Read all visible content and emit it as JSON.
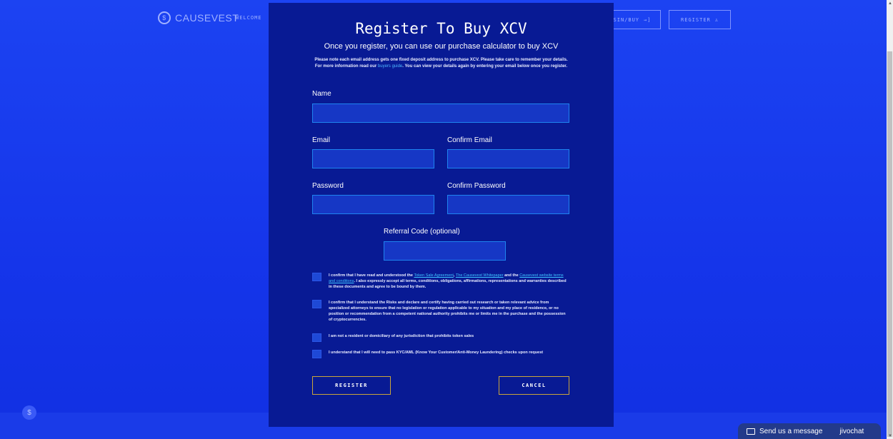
{
  "header": {
    "brand": "CAUSEVEST",
    "brand_icon": "causevest-logo-icon",
    "nav_welcome": "WELCOME",
    "login_button": "SIN/BUY",
    "login_icon": "→]",
    "register_button": "REGISTER",
    "register_icon": "♙"
  },
  "modal": {
    "title": "Register To Buy XCV",
    "subtitle": "Once you register, you can use our purchase calculator to buy XCV",
    "desc_before_link": "Please note each email address gets one fixed deposit address to purchase XCV. Please take care to remember your details. For more information read our ",
    "desc_link": "buyers guide",
    "desc_after_link": ". You can view your details again by entering your email below once you register.",
    "fields": {
      "name_label": "Name",
      "name_value": "",
      "email_label": "Email",
      "email_value": "",
      "confirm_email_label": "Confirm Email",
      "confirm_email_value": "",
      "password_label": "Password",
      "password_value": "",
      "confirm_password_label": "Confirm Password",
      "confirm_password_value": "",
      "referral_label": "Referral Code (optional)",
      "referral_value": ""
    },
    "checkboxes": {
      "c1_a": "I confirm that I have read and understood the ",
      "c1_link1": "Token Sale Agreement",
      "c1_b": ", ",
      "c1_link2": "The Causevest Whitepaper",
      "c1_c": " and the ",
      "c1_link3": "Causevest website terms and conditions",
      "c1_d": ". I also expressly accept all terms, conditions, obligations, affirmations, representations and warranties described in these documents and agree to be bound by them.",
      "c2": "I confirm that I understand the Risks and declare and certify having carried out research or taken relevant advice from specialized attorneys to ensure that no legislation or regulation applicable to my situation and my place of residence, or no position or recommendation from a competent national authority prohibits me or limits me in the purchase and the possession of cryptocurrencies.",
      "c3": "I am not a resident or domiciliary of any jurisdiction that prohibits token sales",
      "c4": "I understand that I will need to pass KYC/AML (Know Your Customer/Anti-Money Laundering) checks upon request"
    },
    "register_button": "REGISTER",
    "cancel_button": "CANCEL"
  },
  "chat": {
    "message": "Send us a message",
    "brand": "jivochat",
    "icon": "envelope-icon"
  },
  "colors": {
    "background": "#1c43f2",
    "modal": "#081a94",
    "field_border": "#1e84f0",
    "button_border": "#caa53a",
    "link": "#3ec3ff"
  }
}
